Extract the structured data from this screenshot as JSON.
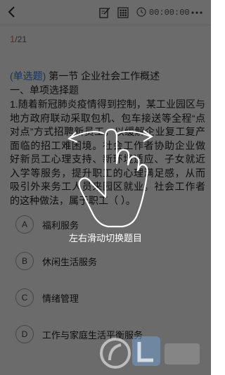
{
  "header": {
    "timer": "00:00:00",
    "icons": [
      "back-icon",
      "edit-icon",
      "grid-icon",
      "clock-icon",
      "more-icon"
    ]
  },
  "progress": {
    "current": "1",
    "total": "/21"
  },
  "question": {
    "type": "(单选题)",
    "chapter": "第一节 企业社会工作概述",
    "section": "一、单项选择题",
    "text": "1.随着新冠肺炎疫情得到控制，某工业园区与地方政府联动采取包机、包车接送等全程“点对点”方式招聘新员工，以缓解企业复工复产面临的招工难困境。社会工作者协助企业做好新员工心理支持、新环境适应、子女就近入学等服务，提升职工的心理满足感，从而吸引外来务工人员来园区就业。社会工作者的这种做法，属于职工（  ）。",
    "options": [
      {
        "letter": "A",
        "text": "福利服务"
      },
      {
        "letter": "B",
        "text": "休闲生活服务"
      },
      {
        "letter": "C",
        "text": "情绪管理"
      },
      {
        "letter": "D",
        "text": "工作与家庭生活平衡服务"
      }
    ]
  },
  "overlay": {
    "hint": "左右滑动切换题目"
  }
}
